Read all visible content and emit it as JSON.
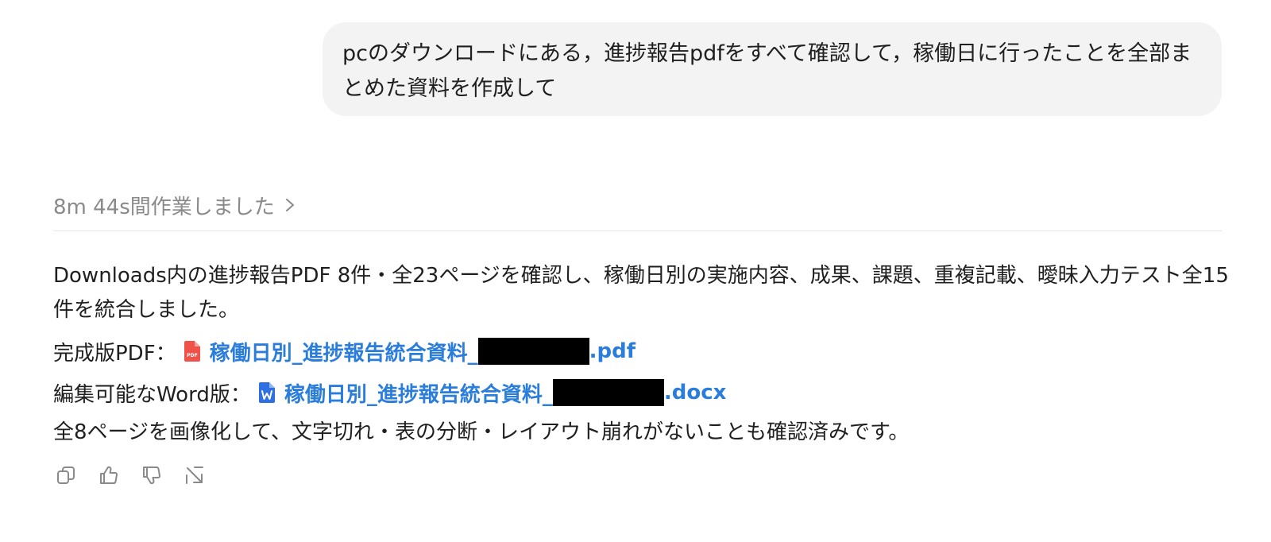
{
  "user_message": {
    "text": "pcのダウンロードにある，進捗報告pdfをすべて確認して，稼働日に行ったことを全部まとめた資料を作成して"
  },
  "worked": {
    "label": "8m 44s間作業しました",
    "icon": "chevron-right-icon"
  },
  "response": {
    "summary": "Downloads内の進捗報告PDF 8件・全23ページを確認し、稼働日別の実施内容、成果、課題、重複記載、曖昧入力テスト全15件を統合しました。",
    "pdf_line": {
      "label": "完成版PDF：",
      "icon": "pdf-file-icon",
      "link_prefix": "稼働日別_進捗報告統合資料_",
      "link_suffix": ".pdf"
    },
    "word_line": {
      "label": "編集可能なWord版：",
      "icon": "word-file-icon",
      "link_prefix": "稼働日別_進捗報告統合資料_",
      "link_suffix": ".docx"
    },
    "closing": "全8ページを画像化して、文字切れ・表の分断・レイアウト崩れがないことも確認済みです。"
  },
  "actions": [
    {
      "icon": "copy-icon"
    },
    {
      "icon": "thumbs-up-icon"
    },
    {
      "icon": "thumbs-down-icon"
    },
    {
      "icon": "share-icon"
    }
  ],
  "colors": {
    "link": "#2b7ddc",
    "pdf_icon": "#f0524a",
    "word_icon": "#2f6fe4",
    "muted": "#8a8a8a",
    "bubble_bg": "#f3f3f3"
  }
}
